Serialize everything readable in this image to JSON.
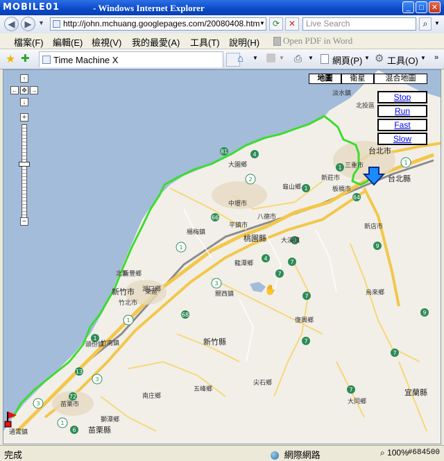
{
  "window": {
    "logo": "MOBILE01",
    "title": "- Windows Internet Explorer",
    "minimize": "_",
    "maximize": "□",
    "close": "✕"
  },
  "address": {
    "url": "http://john.mchuang.googlepages.com/20080408.htm",
    "search_placeholder": "Live Search"
  },
  "menu": {
    "items": [
      "檔案(F)",
      "編輯(E)",
      "檢視(V)",
      "我的最愛(A)",
      "工具(T)",
      "說明(H)"
    ],
    "pdf_label": "Open PDF in Word"
  },
  "tabs": {
    "active_tab": "Time Machine X",
    "page_label": "網頁(P)",
    "tools_label": "工具(O)"
  },
  "map": {
    "types": [
      "地圖",
      "衛星",
      "混合地圖"
    ],
    "active_type": "地圖",
    "controls": [
      "Stop",
      "Run",
      "Fast",
      "Slow"
    ],
    "places": {
      "danshui": "淡水鎮",
      "beitou": "北投區",
      "taipei_city": "台北市",
      "sanchong": "三重市",
      "taipei_county": "台北縣",
      "banqiao": "板橋市",
      "xinzhuang": "新莊市",
      "guishan": "龜山鄉",
      "dayuan": "大園鄉",
      "zhongli": "中壢市",
      "bade": "八德市",
      "taoyuan_county": "桃園縣",
      "yangmei": "楊梅鎮",
      "dashi": "大溪鎮",
      "pingzhen": "平鎮市",
      "longtan": "龍潭鄉",
      "guanxi": "關西鎮",
      "hukou": "湖口鄉",
      "xinfeng": "新豐鄉",
      "xindian": "新店市",
      "wulai": "烏來鄉",
      "fuxing": "復興鄉",
      "hsinchu_city": "新竹市",
      "dongqu": "東區",
      "beiqu": "北區",
      "zhubei": "竹北市",
      "hsinchu_county": "新竹縣",
      "zhunan": "竹南鎮",
      "toufen": "頭份鎮",
      "miaoli_city": "苗栗市",
      "miaoli_county": "苗栗縣",
      "tongxiao": "通霄鎮",
      "shitan": "獅潭鄉",
      "nanzhuang": "南庄鄉",
      "wufeng": "五峰鄉",
      "jianshi": "尖石鄉",
      "datong": "大同鄉",
      "yilan_county": "宜蘭縣"
    },
    "route_color": "#3ddc2e"
  },
  "status": {
    "text": "完成",
    "zone": "網際網路",
    "zoom": "100%",
    "watermark": "#684500"
  }
}
